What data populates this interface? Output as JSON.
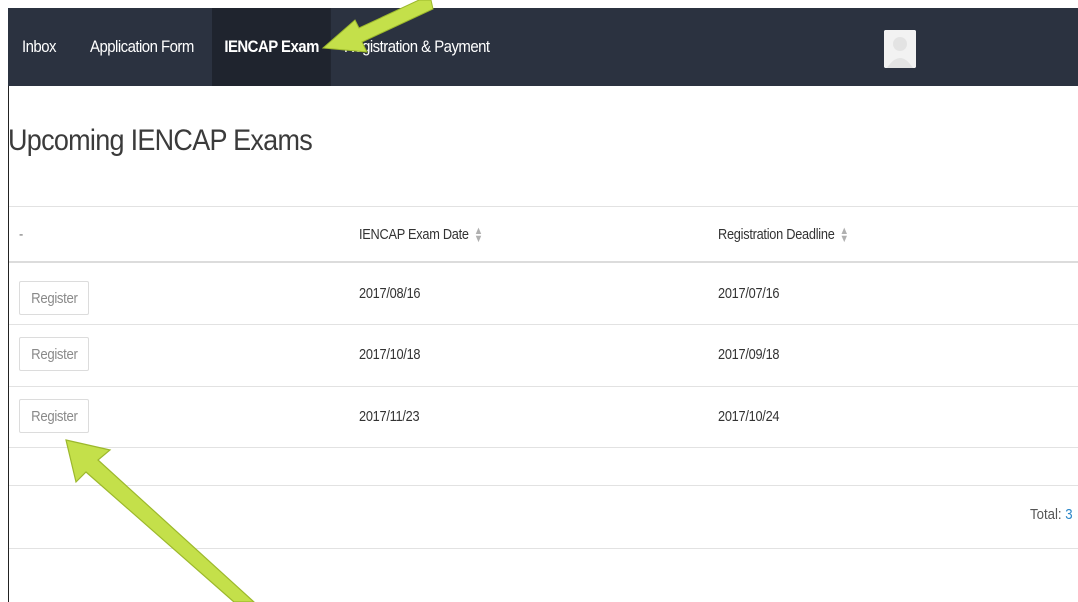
{
  "navbar": {
    "items": [
      {
        "label": "Inbox",
        "active": false
      },
      {
        "label": "Application Form",
        "active": false
      },
      {
        "label": "IENCAP Exam",
        "active": true
      },
      {
        "label": "Registration & Payment",
        "active": false
      }
    ]
  },
  "page": {
    "title": "Upcoming IENCAP Exams"
  },
  "table": {
    "headers": [
      "-",
      "IENCAP Exam Date",
      "Registration Deadline"
    ],
    "rows": [
      {
        "action": "Register",
        "exam_date": "2017/08/16",
        "deadline": "2017/07/16"
      },
      {
        "action": "Register",
        "exam_date": "2017/10/18",
        "deadline": "2017/09/18"
      },
      {
        "action": "Register",
        "exam_date": "2017/11/23",
        "deadline": "2017/10/24"
      }
    ]
  },
  "footer": {
    "total_label": "Total:",
    "total_value": "3"
  },
  "colors": {
    "navbar_bg": "#2b3240",
    "active_tab_bg": "#1f242e",
    "annotation_arrow": "#c4e04a",
    "link_blue": "#2a86c8"
  },
  "icons": {
    "sort": "sort-updown-icon",
    "avatar": "user-avatar-icon",
    "annotation": "highlight-arrow-icon"
  }
}
